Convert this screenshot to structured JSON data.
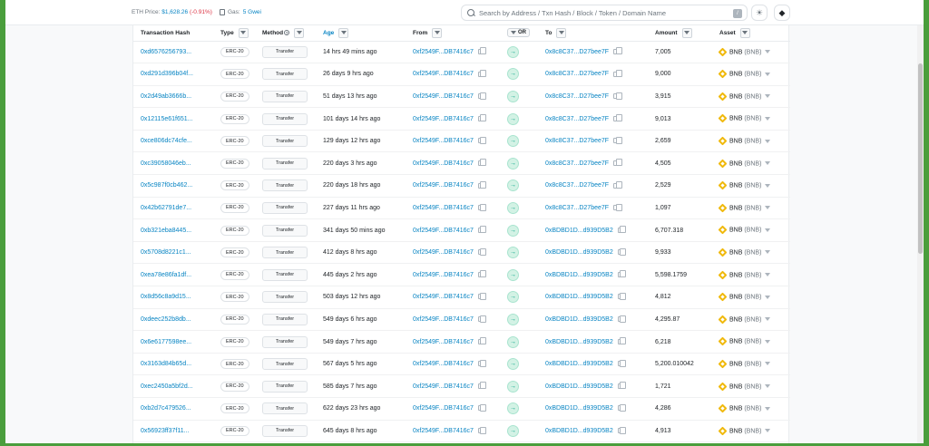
{
  "header": {
    "eth_price_label": "ETH Price:",
    "eth_price_value": "$1,628.26",
    "eth_price_change": "(-0.91%)",
    "gas_label": "Gas:",
    "gas_value": "5 Gwei",
    "search_placeholder": "Search by Address / Txn Hash / Block / Token / Domain Name",
    "search_shortcut": "/",
    "theme_icon": "sun-icon",
    "network_icon": "ethereum-icon"
  },
  "table": {
    "columns": {
      "hash": "Transaction Hash",
      "type": "Type",
      "method": "Method",
      "age": "Age",
      "from": "From",
      "or": "OR",
      "to": "To",
      "amount": "Amount",
      "asset": "Asset"
    },
    "rows": [
      {
        "hash": "0xd6576256793...",
        "type": "ERC-20",
        "method": "Transfer",
        "age": "14 hrs 49 mins ago",
        "from": "0xf2549F...DB7416c7",
        "to": "0x8c8C37...D27bee7F",
        "amount": "7,005",
        "asset": "BNB",
        "symbol": "(BNB)"
      },
      {
        "hash": "0xd291d396b04f...",
        "type": "ERC-20",
        "method": "Transfer",
        "age": "26 days 9 hrs ago",
        "from": "0xf2549F...DB7416c7",
        "to": "0x8c8C37...D27bee7F",
        "amount": "9,000",
        "asset": "BNB",
        "symbol": "(BNB)"
      },
      {
        "hash": "0x2d49ab3666b...",
        "type": "ERC-20",
        "method": "Transfer",
        "age": "51 days 13 hrs ago",
        "from": "0xf2549F...DB7416c7",
        "to": "0x8c8C37...D27bee7F",
        "amount": "3,915",
        "asset": "BNB",
        "symbol": "(BNB)"
      },
      {
        "hash": "0x12115e61f651...",
        "type": "ERC-20",
        "method": "Transfer",
        "age": "101 days 14 hrs ago",
        "from": "0xf2549F...DB7416c7",
        "to": "0x8c8C37...D27bee7F",
        "amount": "9,013",
        "asset": "BNB",
        "symbol": "(BNB)"
      },
      {
        "hash": "0xce806dc74cfe...",
        "type": "ERC-20",
        "method": "Transfer",
        "age": "129 days 12 hrs ago",
        "from": "0xf2549F...DB7416c7",
        "to": "0x8c8C37...D27bee7F",
        "amount": "2,659",
        "asset": "BNB",
        "symbol": "(BNB)"
      },
      {
        "hash": "0xc39058046eb...",
        "type": "ERC-20",
        "method": "Transfer",
        "age": "220 days 3 hrs ago",
        "from": "0xf2549F...DB7416c7",
        "to": "0x8c8C37...D27bee7F",
        "amount": "4,505",
        "asset": "BNB",
        "symbol": "(BNB)"
      },
      {
        "hash": "0x5c987f0cb462...",
        "type": "ERC-20",
        "method": "Transfer",
        "age": "220 days 18 hrs ago",
        "from": "0xf2549F...DB7416c7",
        "to": "0x8c8C37...D27bee7F",
        "amount": "2,529",
        "asset": "BNB",
        "symbol": "(BNB)"
      },
      {
        "hash": "0x42b62791de7...",
        "type": "ERC-20",
        "method": "Transfer",
        "age": "227 days 11 hrs ago",
        "from": "0xf2549F...DB7416c7",
        "to": "0x8c8C37...D27bee7F",
        "amount": "1,097",
        "asset": "BNB",
        "symbol": "(BNB)"
      },
      {
        "hash": "0xb321eba8445...",
        "type": "ERC-20",
        "method": "Transfer",
        "age": "341 days 50 mins ago",
        "from": "0xf2549F...DB7416c7",
        "to": "0xBDBD1D...d939D5B2",
        "amount": "6,707.318",
        "asset": "BNB",
        "symbol": "(BNB)"
      },
      {
        "hash": "0x5708d8221c1...",
        "type": "ERC-20",
        "method": "Transfer",
        "age": "412 days 8 hrs ago",
        "from": "0xf2549F...DB7416c7",
        "to": "0xBDBD1D...d939D5B2",
        "amount": "9,933",
        "asset": "BNB",
        "symbol": "(BNB)"
      },
      {
        "hash": "0xea78e86fa1df...",
        "type": "ERC-20",
        "method": "Transfer",
        "age": "445 days 2 hrs ago",
        "from": "0xf2549F...DB7416c7",
        "to": "0xBDBD1D...d939D5B2",
        "amount": "5,598.1759",
        "asset": "BNB",
        "symbol": "(BNB)"
      },
      {
        "hash": "0x8d56c8a9d15...",
        "type": "ERC-20",
        "method": "Transfer",
        "age": "503 days 12 hrs ago",
        "from": "0xf2549F...DB7416c7",
        "to": "0xBDBD1D...d939D5B2",
        "amount": "4,812",
        "asset": "BNB",
        "symbol": "(BNB)"
      },
      {
        "hash": "0xdeec252b8db...",
        "type": "ERC-20",
        "method": "Transfer",
        "age": "549 days 6 hrs ago",
        "from": "0xf2549F...DB7416c7",
        "to": "0xBDBD1D...d939D5B2",
        "amount": "4,295.87",
        "asset": "BNB",
        "symbol": "(BNB)"
      },
      {
        "hash": "0x6e6177598ee...",
        "type": "ERC-20",
        "method": "Transfer",
        "age": "549 days 7 hrs ago",
        "from": "0xf2549F...DB7416c7",
        "to": "0xBDBD1D...d939D5B2",
        "amount": "6,218",
        "asset": "BNB",
        "symbol": "(BNB)"
      },
      {
        "hash": "0x3163d84b65d...",
        "type": "ERC-20",
        "method": "Transfer",
        "age": "567 days 5 hrs ago",
        "from": "0xf2549F...DB7416c7",
        "to": "0xBDBD1D...d939D5B2",
        "amount": "5,200.010042",
        "asset": "BNB",
        "symbol": "(BNB)"
      },
      {
        "hash": "0xec2450a5bf2d...",
        "type": "ERC-20",
        "method": "Transfer",
        "age": "585 days 7 hrs ago",
        "from": "0xf2549F...DB7416c7",
        "to": "0xBDBD1D...d939D5B2",
        "amount": "1,721",
        "asset": "BNB",
        "symbol": "(BNB)"
      },
      {
        "hash": "0xb2d7c479526...",
        "type": "ERC-20",
        "method": "Transfer",
        "age": "622 days 23 hrs ago",
        "from": "0xf2549F...DB7416c7",
        "to": "0xBDBD1D...d939D5B2",
        "amount": "4,286",
        "asset": "BNB",
        "symbol": "(BNB)"
      },
      {
        "hash": "0x56923ff37f11...",
        "type": "ERC-20",
        "method": "Transfer",
        "age": "645 days 8 hrs ago",
        "from": "0xf2549F...DB7416c7",
        "to": "0xBDBD1D...d939D5B2",
        "amount": "4,913",
        "asset": "BNB",
        "symbol": "(BNB)"
      }
    ]
  },
  "colors": {
    "link": "#0784c3",
    "negative": "#dc3545",
    "in_badge": "#00a186",
    "bnb": "#f0b90b",
    "frame_border": "#4a9e3c"
  }
}
